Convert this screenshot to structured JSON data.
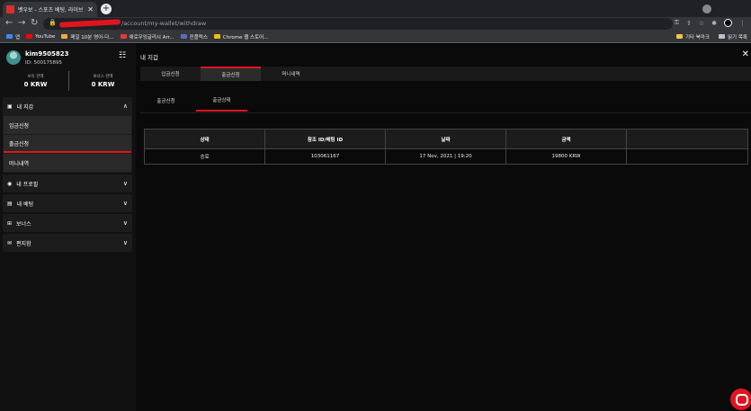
{
  "browser": {
    "tab_title": "벳우보 - 스포츠 베팅, 라이브 카...",
    "tab_close": "✕",
    "new_tab": "+",
    "url": "/account/my-wallet/withdraw",
    "bookmarks": [
      {
        "label": "앱",
        "color": "#4285f4"
      },
      {
        "label": "YouTube",
        "color": "#ff0000"
      },
      {
        "label": "매일 10분 영어-다...",
        "color": "#f6ad3b"
      },
      {
        "label": "애로우잉글리시 Arr...",
        "color": "#e53935"
      },
      {
        "label": "컨플럭스",
        "color": "#5c6bc0"
      },
      {
        "label": "Chrome 웹 스토어...",
        "color": "#fbbc05"
      }
    ],
    "bookmarks_right": [
      "기타 북마크",
      "읽기 목록"
    ]
  },
  "user": {
    "name": "kim9505823",
    "id": "ID: 500175895",
    "balances": [
      {
        "label": "보유 잔액",
        "value": "0 KRW"
      },
      {
        "label": "보너스 잔액",
        "value": "0 KRW"
      }
    ]
  },
  "sidebar": {
    "wallet": {
      "label": "내 지갑",
      "items": [
        "입금신청",
        "출금신청",
        "머니내역"
      ]
    },
    "sections": [
      {
        "label": "내 프로필"
      },
      {
        "label": "내 베팅"
      },
      {
        "label": "보너스"
      },
      {
        "label": "편지함"
      }
    ]
  },
  "main": {
    "title": "내 지갑",
    "close": "✕",
    "tabs": [
      "입금신청",
      "출금신청",
      "머니내역"
    ],
    "subtabs": [
      "출금신청",
      "출금상태"
    ],
    "table": {
      "headers": [
        "상태",
        "참조 ID/베팅 ID",
        "날짜",
        "금액",
        ""
      ],
      "rows": [
        [
          "승료",
          "103061167",
          "17 Nov, 2021 | 19:20",
          "19800 KRW",
          ""
        ]
      ]
    }
  },
  "colors": {
    "accent": "#e0151f"
  }
}
